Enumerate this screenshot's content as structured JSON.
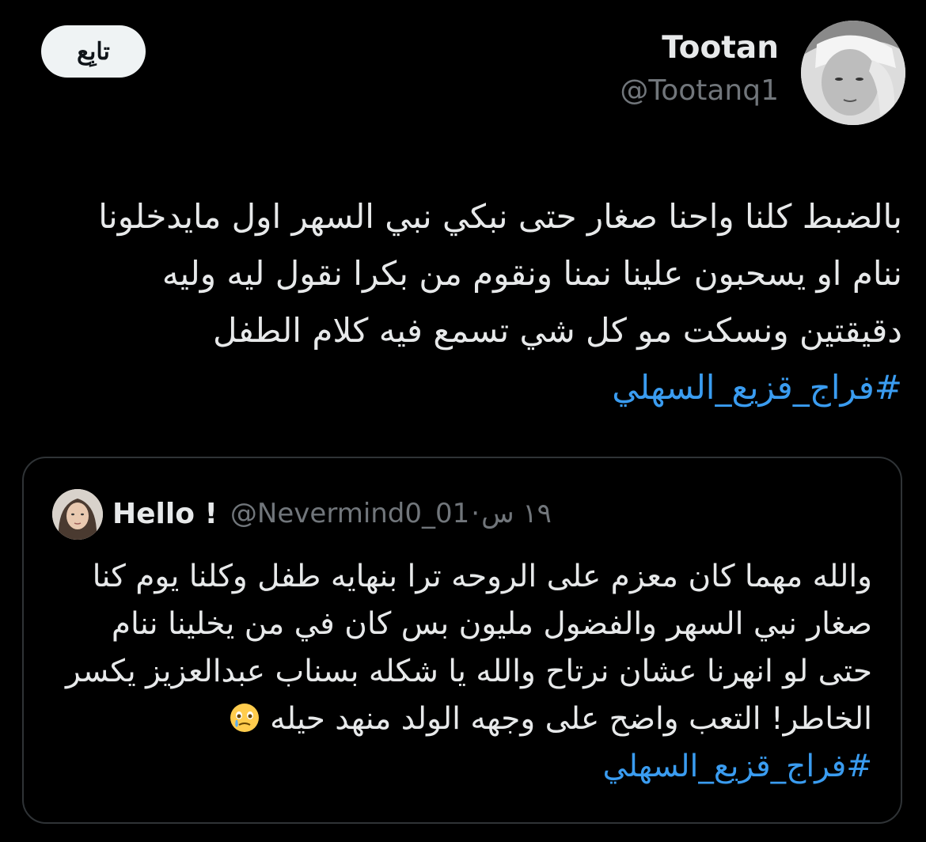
{
  "tweet": {
    "author": {
      "name": "Tootan",
      "handle": "@Tootanq1"
    },
    "follow_label": "تابِع",
    "text_lines": [
      "بالضبط كلنا واحنا صغار حتى نبكي نبي السهر اول مايدخلونا",
      "ننام او يسحبون علينا نمنا ونقوم من بكرا نقول ليه وليه",
      "دقيقتين ونسكت مو كل شي تسمع فيه كلام الطفل"
    ],
    "hashtag": "#فراج_قزيع_السهلي"
  },
  "quote": {
    "author": {
      "name": "Hello !",
      "handle": "@Nevermind0_01",
      "time": "١٩ س"
    },
    "separator": "·",
    "text_lines": [
      "والله مهما كان معزم على الروحه ترا بنهايه طفل وكلنا يوم كنا",
      "صغار نبي السهر والفضول مليون بس كان في من يخلينا ننام",
      "حتى لو انهرنا عشان نرتاح والله يا شكله بسناب عبدالعزيز يكسر",
      "الخاطر! التعب واضح على وجهه الولد منهد حيله"
    ],
    "emoji": "face-holding-back-tears-icon",
    "hashtag": "#فراج_قزيع_السهلي"
  },
  "colors": {
    "background": "#000000",
    "text": "#e7e9ea",
    "muted": "#71767b",
    "hashtag": "#3a9cf0",
    "border": "#2f3336",
    "follow_bg": "#eff3f4"
  }
}
